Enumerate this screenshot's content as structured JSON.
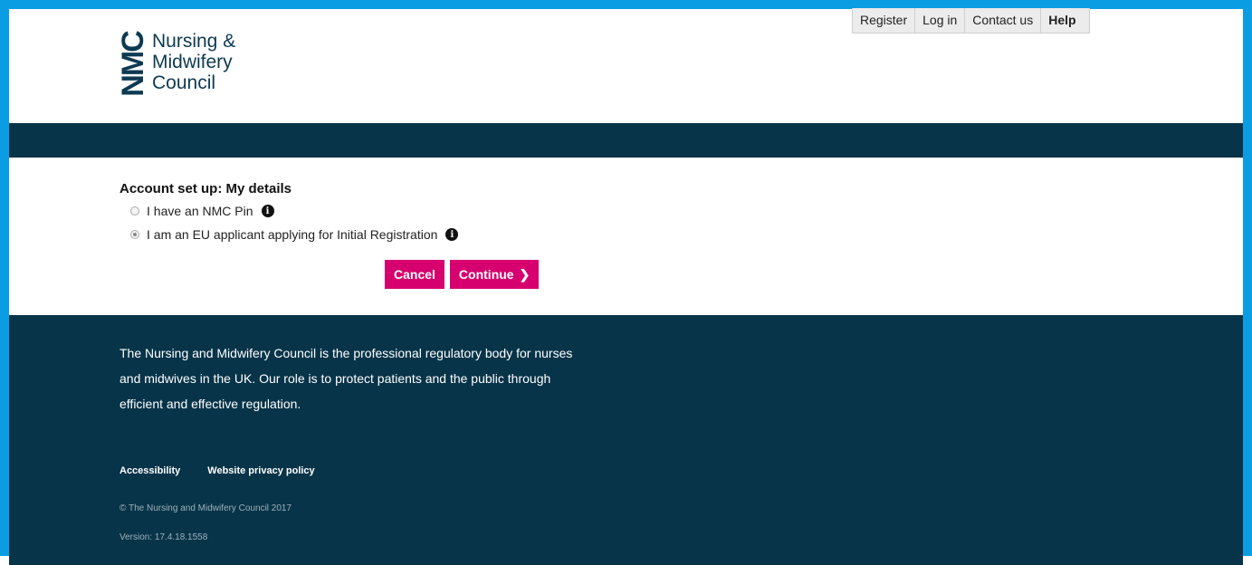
{
  "nav": {
    "register": "Register",
    "login": "Log in",
    "contact": "Contact us",
    "help": "Help"
  },
  "logo": {
    "mark": "NMC",
    "line1": "Nursing &",
    "line2": "Midwifery",
    "line3": "Council"
  },
  "form": {
    "title": "Account set up: My details",
    "options": [
      {
        "label": "I have an NMC Pin",
        "selected": false
      },
      {
        "label": "I am an EU applicant applying for Initial Registration",
        "selected": true
      }
    ],
    "cancel_label": "Cancel",
    "continue_label": "Continue"
  },
  "footer": {
    "about": "The Nursing and Midwifery Council is the professional regulatory body for nurses and midwives in the UK. Our role is to protect patients and the public through efficient and effective regulation.",
    "links": [
      "Accessibility",
      "Website privacy policy"
    ],
    "copyright": "© The Nursing and Midwifery Council 2017",
    "version": "Version: 17.4.18.1558"
  },
  "colors": {
    "frame": "#0b9de3",
    "navy": "#073449",
    "accent": "#d6006e"
  }
}
